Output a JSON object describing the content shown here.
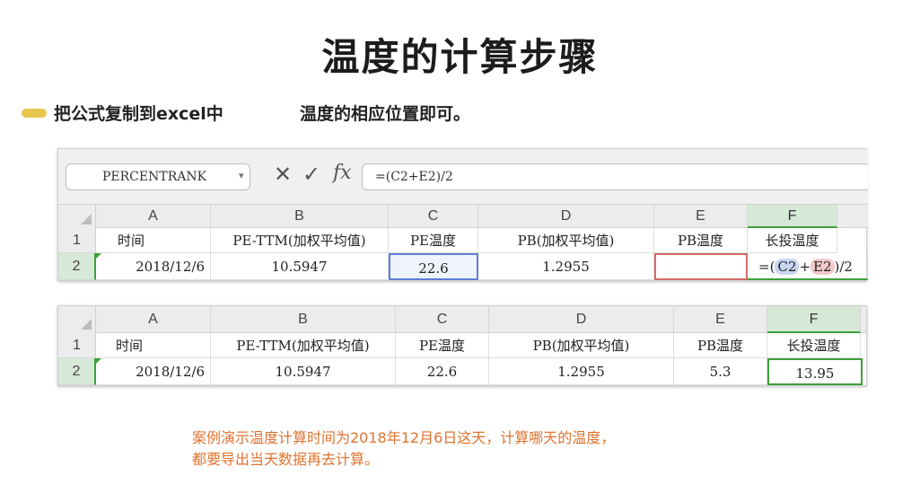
{
  "title": "温度的计算步骤",
  "instruction": {
    "part1": "把公式复制到excel中",
    "part2": "温度的相应位置即可。"
  },
  "formula_bar": {
    "name_box": "PERCENTRANK",
    "cancel_icon": "✕",
    "enter_icon": "✓",
    "fx_label": "fx",
    "formula": "=(C2+E2)/2"
  },
  "sheet1": {
    "columns": [
      "A",
      "B",
      "C",
      "D",
      "E",
      "F"
    ],
    "rows": [
      {
        "num": "1",
        "cells": [
          "时间",
          "PE-TTM(加权平均值)",
          "PE温度",
          "PB(加权平均值)",
          "PB温度",
          "长投温度"
        ]
      },
      {
        "num": "2",
        "cells": [
          "2018/12/6",
          "10.5947",
          "22.6",
          "1.2955",
          "",
          "=(C2+E2)/2"
        ]
      }
    ],
    "edit_formula": {
      "prefix": "=(",
      "ref1": "C2",
      "plus": "+",
      "ref2": "E2",
      "suffix": ")/2"
    }
  },
  "sheet2": {
    "columns": [
      "A",
      "B",
      "C",
      "D",
      "E",
      "F"
    ],
    "rows": [
      {
        "num": "1",
        "cells": [
          "时间",
          "PE-TTM(加权平均值)",
          "PE温度",
          "PB(加权平均值)",
          "PB温度",
          "长投温度"
        ]
      },
      {
        "num": "2",
        "cells": [
          "2018/12/6",
          "10.5947",
          "22.6",
          "1.2955",
          "5.3",
          "13.95"
        ]
      }
    ]
  },
  "caption": {
    "line1": "案例演示温度计算时间为2018年12月6日这天，计算哪天的温度，",
    "line2": "都要导出当天数据再去计算。"
  },
  "colors": {
    "accent_bullet": "#e8c64e",
    "caption": "#e07330",
    "selection_green": "#3ca03c",
    "ref_blue": "#5b7fd6",
    "ref_red": "#d66a6a"
  }
}
